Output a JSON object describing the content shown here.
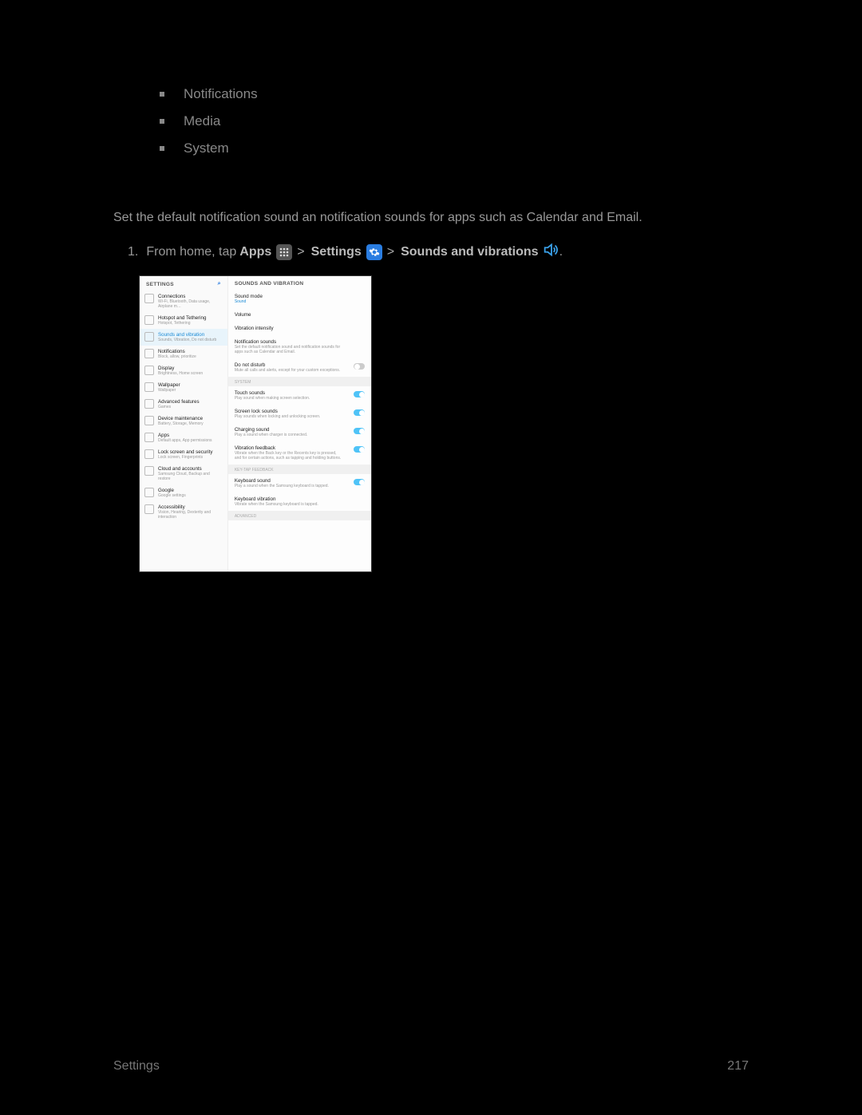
{
  "bullets": [
    "Notifications",
    "Media",
    "System"
  ],
  "description": "Set the default notification sound an notification sounds for apps such as Calendar and Email.",
  "step": {
    "number": "1.",
    "prefix": "From home, tap",
    "apps": "Apps",
    "settings": "Settings",
    "sounds": "Sounds and vibrations",
    "sep": ">"
  },
  "screenshot": {
    "left_header": "SETTINGS",
    "right_header": "SOUNDS AND VIBRATION",
    "left_items": [
      {
        "title": "Connections",
        "sub": "Wi-Fi, Bluetooth, Data usage, Airplane m…"
      },
      {
        "title": "Hotspot and Tethering",
        "sub": "Hotspot, Tethering"
      },
      {
        "title": "Sounds and vibration",
        "sub": "Sounds, Vibration, Do not disturb",
        "active": true
      },
      {
        "title": "Notifications",
        "sub": "Block, allow, prioritize"
      },
      {
        "title": "Display",
        "sub": "Brightness, Home screen"
      },
      {
        "title": "Wallpaper",
        "sub": "Wallpaper"
      },
      {
        "title": "Advanced features",
        "sub": "Games"
      },
      {
        "title": "Device maintenance",
        "sub": "Battery, Storage, Memory"
      },
      {
        "title": "Apps",
        "sub": "Default apps, App permissions"
      },
      {
        "title": "Lock screen and security",
        "sub": "Lock screen, Fingerprints"
      },
      {
        "title": "Cloud and accounts",
        "sub": "Samsung Cloud, Backup and restore"
      },
      {
        "title": "Google",
        "sub": "Google settings"
      },
      {
        "title": "Accessibility",
        "sub": "Vision, Hearing, Dexterity and interaction"
      }
    ],
    "right_items": [
      {
        "type": "setting",
        "title": "Sound mode",
        "val": "Sound"
      },
      {
        "type": "setting",
        "title": "Volume"
      },
      {
        "type": "setting",
        "title": "Vibration intensity"
      },
      {
        "type": "setting",
        "title": "Notification sounds",
        "sub": "Set the default notification sound and notification sounds for apps such as Calendar and Email."
      },
      {
        "type": "setting",
        "title": "Do not disturb",
        "sub": "Mute all calls and alerts, except for your custom exceptions.",
        "toggle": "off"
      },
      {
        "type": "group",
        "label": "SYSTEM"
      },
      {
        "type": "setting",
        "title": "Touch sounds",
        "sub": "Play sound when making screen selection.",
        "toggle": "on"
      },
      {
        "type": "setting",
        "title": "Screen lock sounds",
        "sub": "Play sounds when locking and unlocking screen.",
        "toggle": "on"
      },
      {
        "type": "setting",
        "title": "Charging sound",
        "sub": "Play a sound when charger is connected.",
        "toggle": "on"
      },
      {
        "type": "setting",
        "title": "Vibration feedback",
        "sub": "Vibrate when the Back key or the Recents key is pressed, and for certain actions, such as tapping and holding buttons.",
        "toggle": "on"
      },
      {
        "type": "group",
        "label": "KEY-TAP FEEDBACK"
      },
      {
        "type": "setting",
        "title": "Keyboard sound",
        "sub": "Play a sound when the Samsung keyboard is tapped.",
        "toggle": "on"
      },
      {
        "type": "setting",
        "title": "Keyboard vibration",
        "sub": "Vibrate when the Samsung keyboard is tapped."
      },
      {
        "type": "group",
        "label": "ADVANCED"
      }
    ]
  },
  "footer": {
    "left": "Settings",
    "right": "217"
  }
}
